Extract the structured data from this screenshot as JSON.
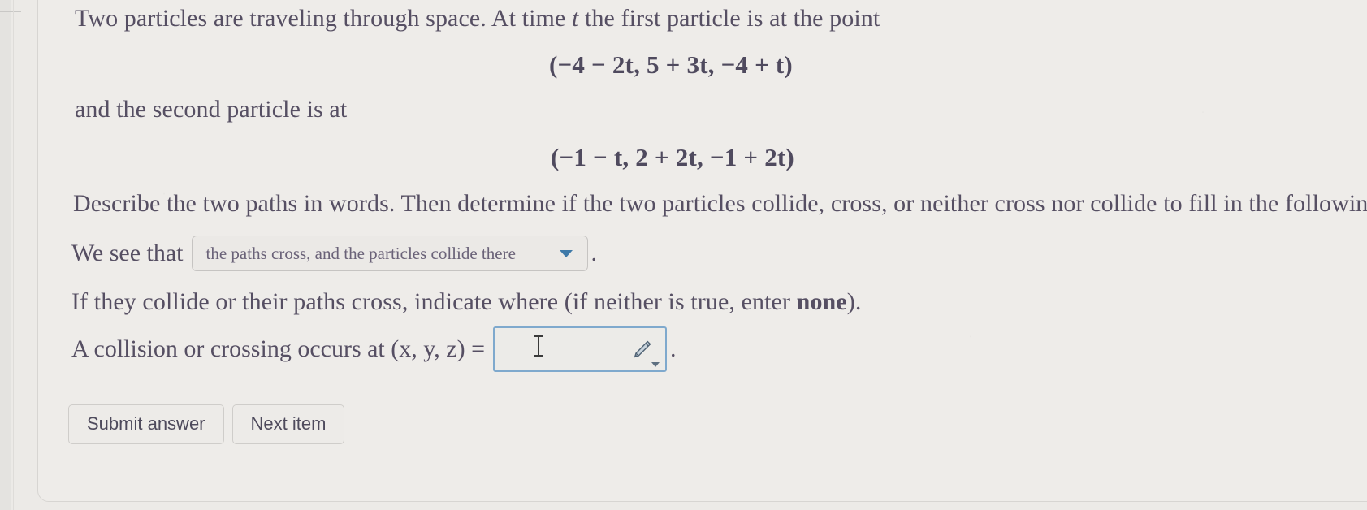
{
  "problem": {
    "line1_a": "Two particles are traveling through space. At time ",
    "line1_t": "t",
    "line1_b": " the first particle is at the point",
    "display_math_1": "(−4 − 2t, 5 + 3t, −4 + t)",
    "line2": "and the second particle is at",
    "display_math_2": "(−1 − t, 2 + 2t, −1 + 2t)",
    "line3": "Describe the two paths in words. Then determine if the two particles collide, cross, or neither cross nor collide to fill in the following.",
    "line4_prefix": "We see that",
    "line4_suffix": ".",
    "line5_a": "If they collide or their paths cross, indicate where (if neither is true, enter ",
    "line5_bold": "none",
    "line5_b": ").",
    "line6_prefix": "A collision or crossing occurs at (x, y, z) =",
    "line6_suffix": "."
  },
  "dropdown": {
    "selected": "the paths cross, and the particles collide there",
    "icon": "chevron-down-icon"
  },
  "answer_input": {
    "value": "",
    "placeholder": "",
    "cursor_icon": "text-ibeam-cursor",
    "tool_icon": "pencil-icon",
    "tool_caret_icon": "chevron-down-icon"
  },
  "buttons": {
    "submit": "Submit answer",
    "next": "Next item"
  },
  "colors": {
    "text": "#564f63",
    "math": "#4f4a5e",
    "page_bg": "#eeece9",
    "input_focus_border": "#7fa9cd",
    "caret_blue": "#3e79a8"
  }
}
